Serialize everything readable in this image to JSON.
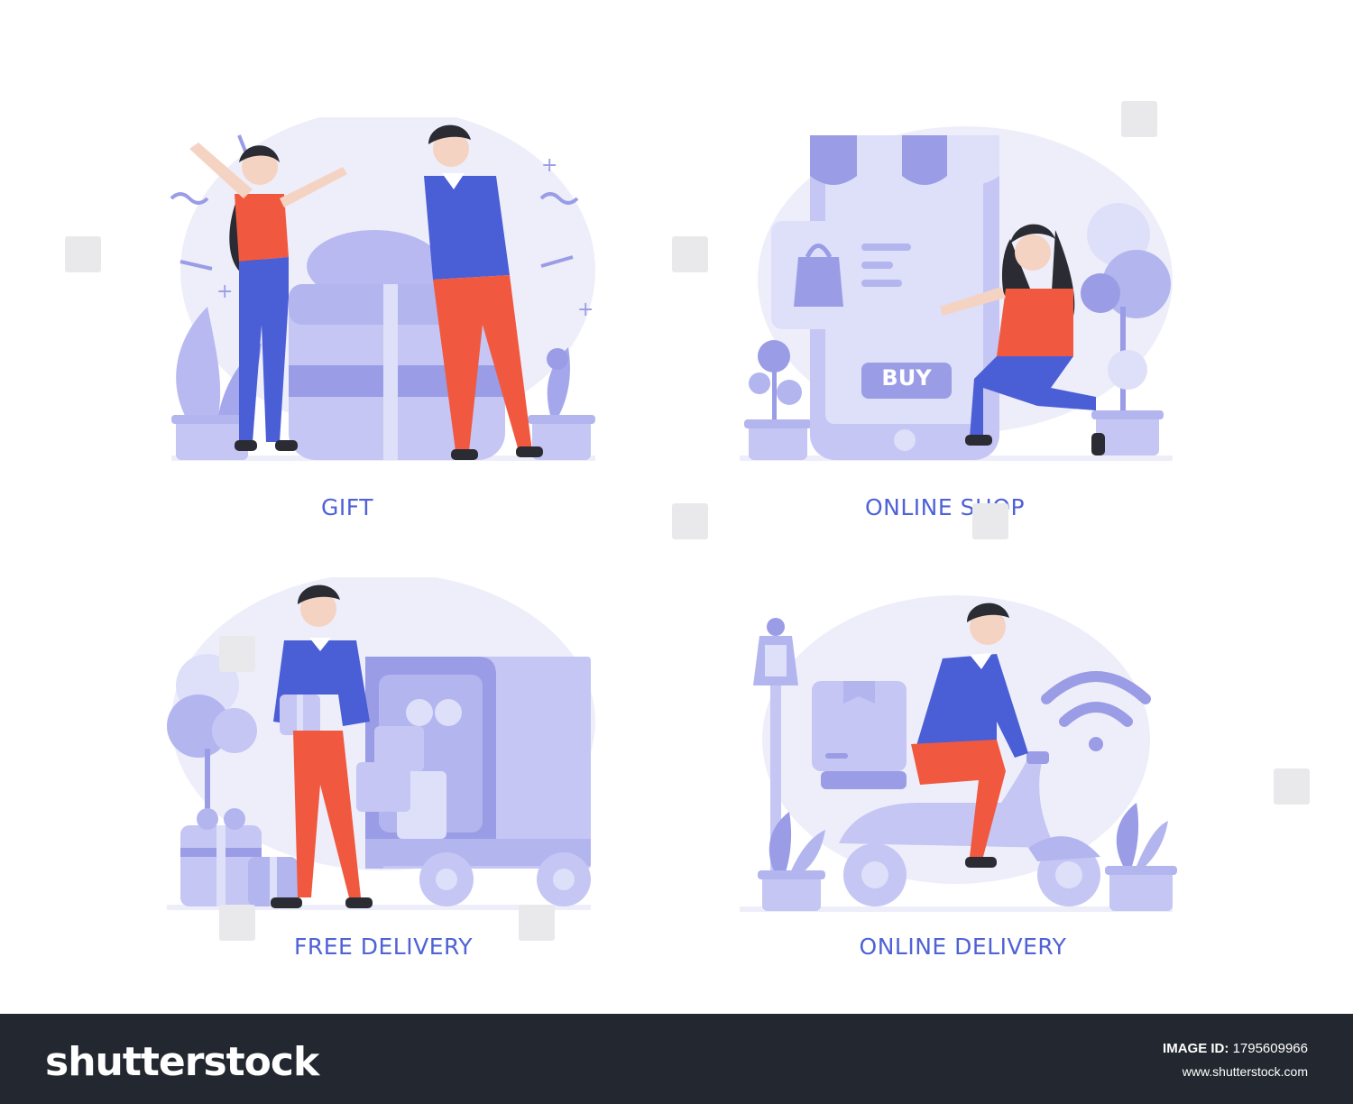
{
  "illustrations": [
    {
      "id": "gift",
      "caption": "GIFT",
      "icon": "gift-box-people"
    },
    {
      "id": "online-shop",
      "caption": "ONLINE SHOP",
      "icon": "phone-store-woman",
      "buy_label": "BUY"
    },
    {
      "id": "free-delivery",
      "caption": "FREE DELIVERY",
      "icon": "truck-man-gift"
    },
    {
      "id": "online-delivery",
      "caption": "ONLINE DELIVERY",
      "icon": "scooter-courier"
    }
  ],
  "footer": {
    "brand": "shutterstock",
    "image_id_label": "IMAGE ID:",
    "image_id": "1795609966",
    "site": "www.shutterstock.com"
  },
  "colors": {
    "primary_text": "#4f62d6",
    "lavender_light": "#eeeefb",
    "lavender_mid": "#c5c6f4",
    "lavender_dark": "#9a9ce6",
    "shirt_red": "#f0593f",
    "shirt_blue": "#4a5ed6",
    "footer_bg": "#232830"
  }
}
